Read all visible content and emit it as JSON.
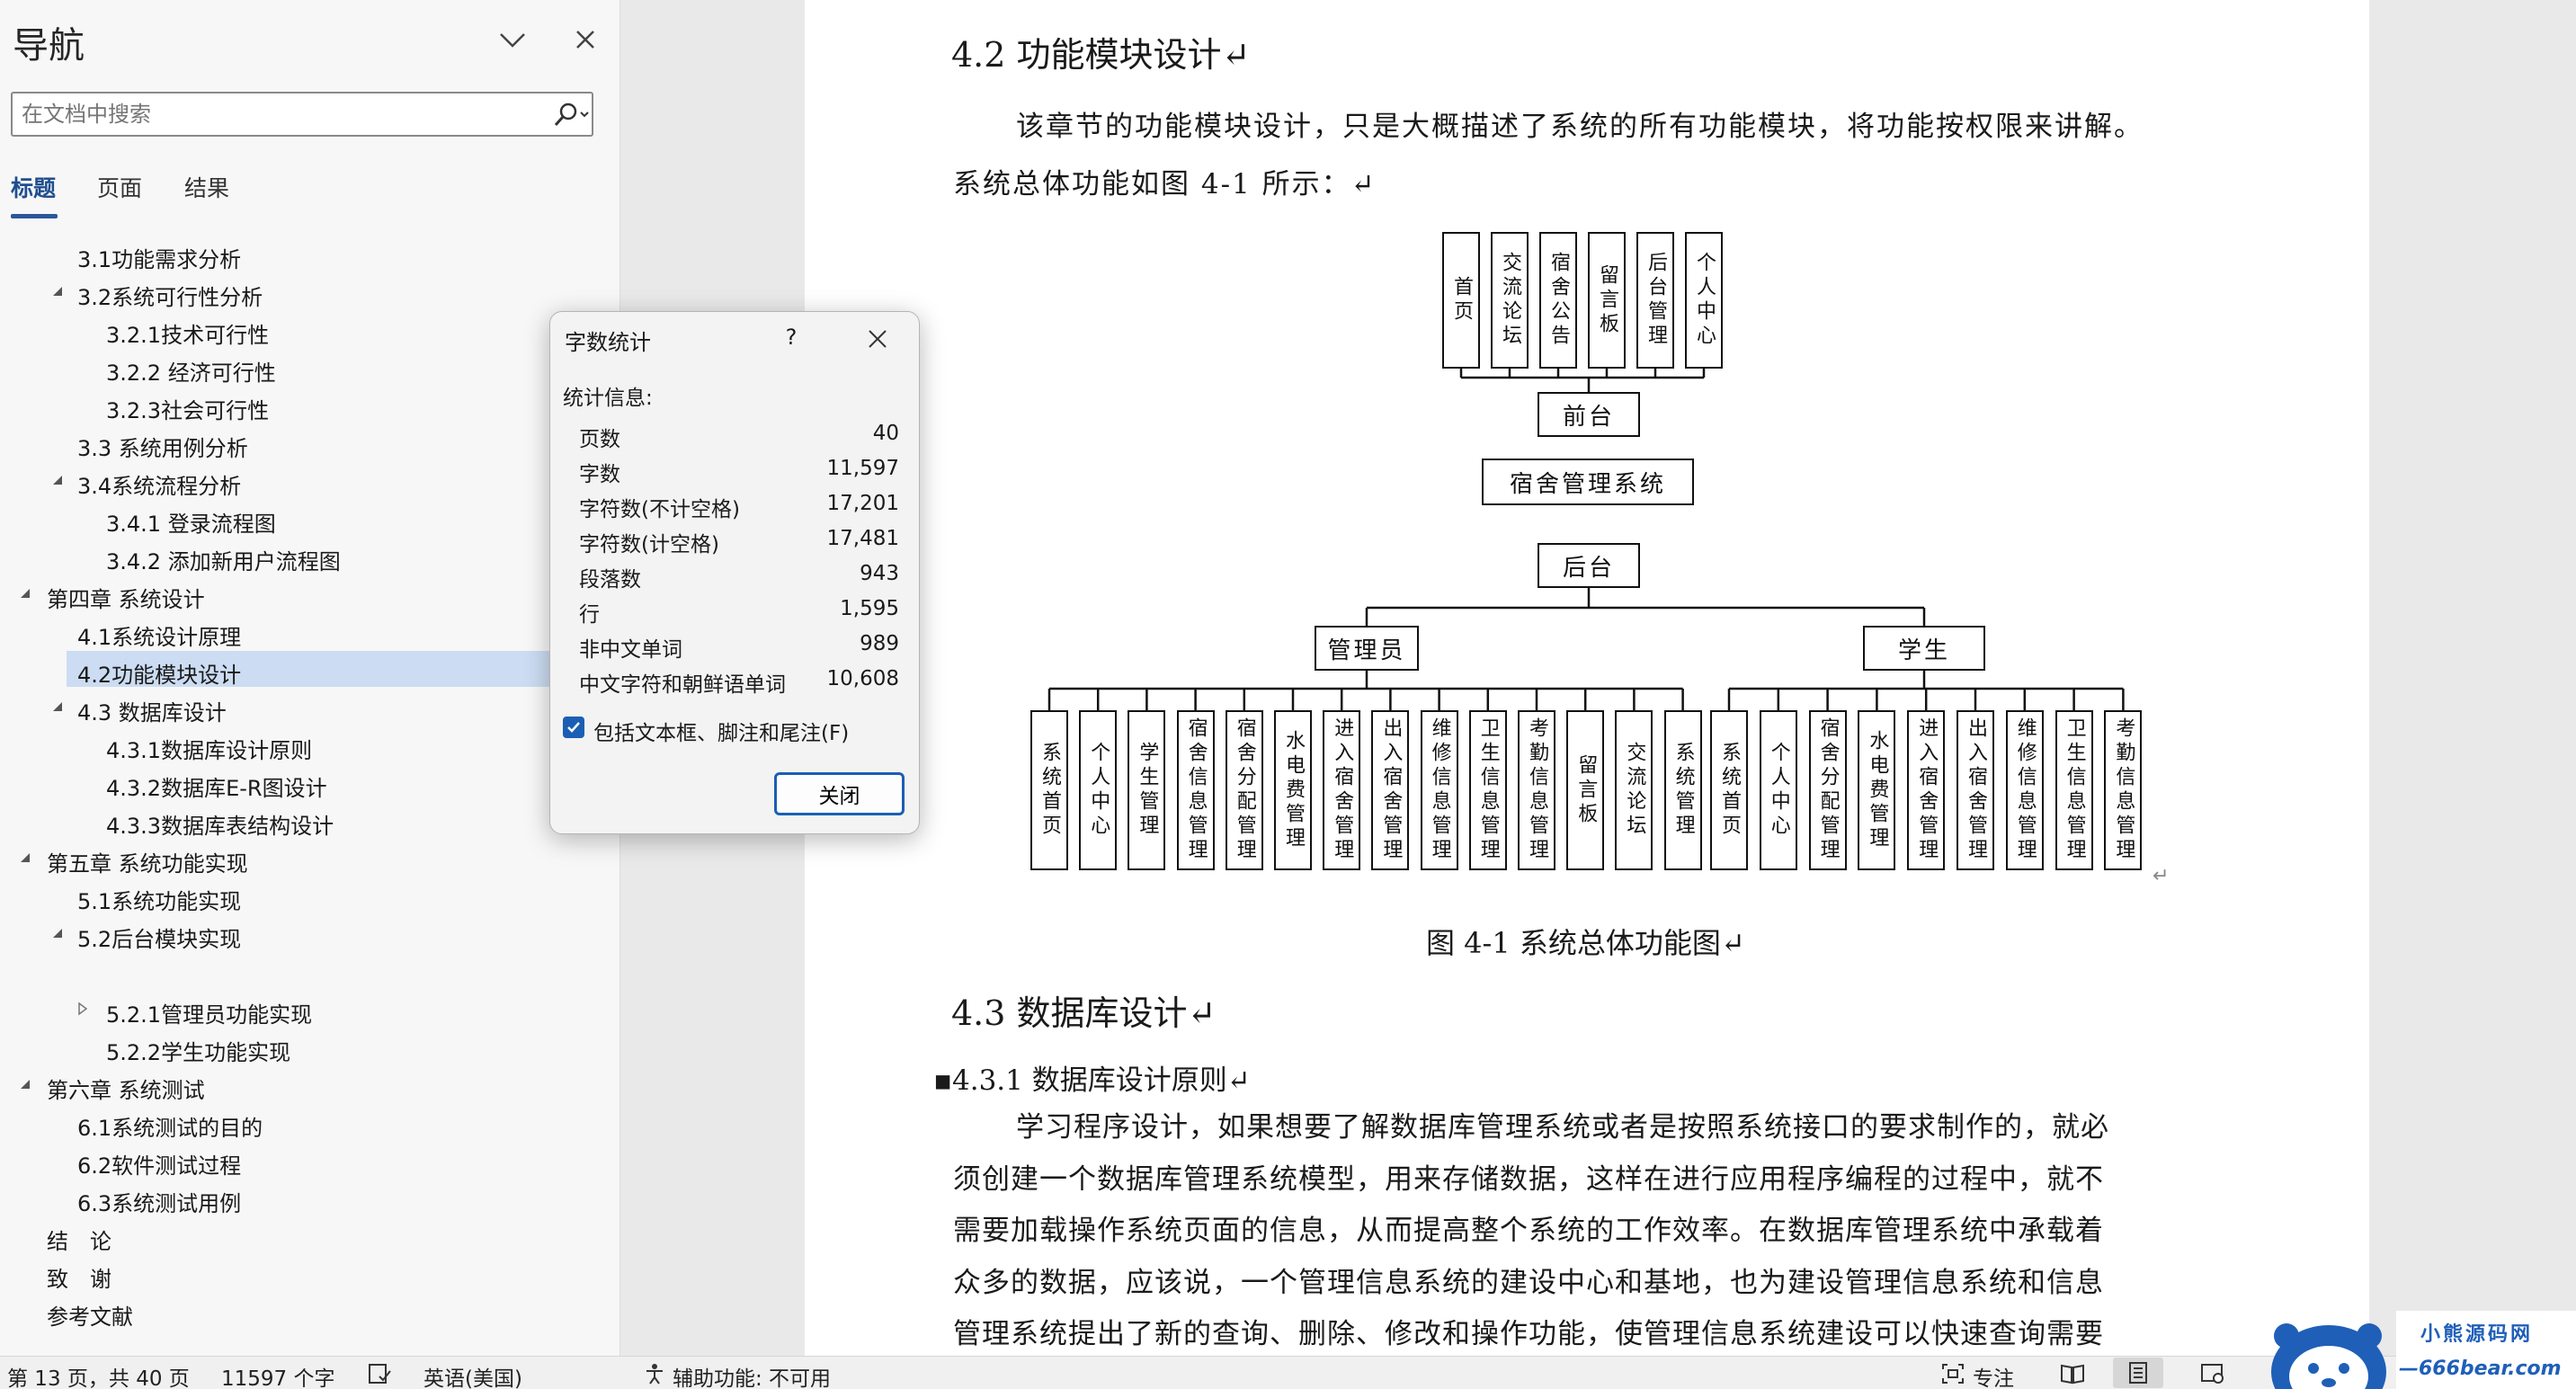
{
  "nav": {
    "title": "导航",
    "search_placeholder": "在文档中搜索",
    "tabs": [
      "标题",
      "页面",
      "结果"
    ],
    "items": [
      {
        "label": "3.1功能需求分析",
        "level": 2,
        "arrow": ""
      },
      {
        "label": "3.2系统可行性分析",
        "level": 2,
        "arrow": "down"
      },
      {
        "label": "3.2.1技术可行性",
        "level": 3,
        "arrow": ""
      },
      {
        "label": "3.2.2 经济可行性",
        "level": 3,
        "arrow": ""
      },
      {
        "label": "3.2.3社会可行性",
        "level": 3,
        "arrow": ""
      },
      {
        "label": "3.3 系统用例分析",
        "level": 2,
        "arrow": ""
      },
      {
        "label": "3.4系统流程分析",
        "level": 2,
        "arrow": "down"
      },
      {
        "label": "3.4.1 登录流程图",
        "level": 3,
        "arrow": ""
      },
      {
        "label": "3.4.2 添加新用户流程图",
        "level": 3,
        "arrow": ""
      },
      {
        "label": "第四章 系统设计",
        "level": 1,
        "arrow": "down"
      },
      {
        "label": "4.1系统设计原理",
        "level": 2,
        "arrow": ""
      },
      {
        "label": "4.2功能模块设计",
        "level": 2,
        "arrow": "",
        "selected": true
      },
      {
        "label": "4.3 数据库设计",
        "level": 2,
        "arrow": "down"
      },
      {
        "label": "4.3.1数据库设计原则",
        "level": 3,
        "arrow": ""
      },
      {
        "label": "4.3.2数据库E-R图设计",
        "level": 3,
        "arrow": ""
      },
      {
        "label": "4.3.3数据库表结构设计",
        "level": 3,
        "arrow": ""
      },
      {
        "label": "第五章 系统功能实现",
        "level": 1,
        "arrow": "down"
      },
      {
        "label": "5.1系统功能实现",
        "level": 2,
        "arrow": ""
      },
      {
        "label": "5.2后台模块实现",
        "level": 2,
        "arrow": "down"
      },
      {
        "label": "",
        "level": 3,
        "arrow": ""
      },
      {
        "label": "5.2.1管理员功能实现",
        "level": 3,
        "arrow": "right"
      },
      {
        "label": "5.2.2学生功能实现",
        "level": 3,
        "arrow": ""
      },
      {
        "label": "第六章 系统测试",
        "level": 1,
        "arrow": "down"
      },
      {
        "label": "6.1系统测试的目的",
        "level": 2,
        "arrow": ""
      },
      {
        "label": "6.2软件测试过程",
        "level": 2,
        "arrow": ""
      },
      {
        "label": "6.3系统测试用例",
        "level": 2,
        "arrow": ""
      },
      {
        "label": "结　论",
        "level": 1,
        "arrow": ""
      },
      {
        "label": "致　谢",
        "level": 1,
        "arrow": ""
      },
      {
        "label": "参考文献",
        "level": 1,
        "arrow": ""
      }
    ]
  },
  "doc": {
    "heading_42": "4.2 功能模块设计↵",
    "para1_line1": "该章节的功能模块设计，只是大概描述了系统的所有功能模块，将功能按权限来讲解。",
    "para1_line2": "系统总体功能如图 4-1 所示：↵",
    "figure_caption": "图 4-1  系统总体功能图↵",
    "heading_43": "4.3  数据库设计↵",
    "heading_431": "▪4.3.1 数据库设计原则↵",
    "body_lines": [
      "学习程序设计，如果想要了解数据库管理系统或者是按照系统接口的要求制作的，就必",
      "须创建一个数据库管理系统模型，用来存储数据，这样在进行应用程序编程的过程中，就不",
      "需要加载操作系统页面的信息，从而提高整个系统的工作效率。在数据库管理系统中承载着",
      "众多的数据，应该说，一个管理信息系统的建设中心和基地，也为建设管理信息系统和信息",
      "管理系统提出了新的查询、删除、修改和操作功能，使管理信息系统建设可以快速查询需要"
    ],
    "diagram": {
      "front_modules": [
        "首页",
        "交流论坛",
        "宿舍公告",
        "留言板",
        "后台管理",
        "个人中心"
      ],
      "front": "前台",
      "root": "宿舍管理系统",
      "back": "后台",
      "admin": "管理员",
      "student": "学生",
      "admin_modules": [
        "系统首页",
        "个人中心",
        "学生管理",
        "宿舍信息管理",
        "宿舍分配管理",
        "水电费管理",
        "进入宿舍管理",
        "出入宿舍管理",
        "维修信息管理",
        "卫生信息管理",
        "考勤信息管理",
        "留言板",
        "交流论坛",
        "系统管理"
      ],
      "student_modules": [
        "系统首页",
        "个人中心",
        "宿舍分配管理",
        "水电费管理",
        "进入宿舍管理",
        "出入宿舍管理",
        "维修信息管理",
        "卫生信息管理",
        "考勤信息管理"
      ],
      "return_mark": "↵"
    }
  },
  "dialog": {
    "title": "字数统计",
    "help": "?",
    "stats_label": "统计信息:",
    "stats": [
      {
        "k": "页数",
        "v": "40"
      },
      {
        "k": "字数",
        "v": "11,597"
      },
      {
        "k": "字符数(不计空格)",
        "v": "17,201"
      },
      {
        "k": "字符数(计空格)",
        "v": "17,481"
      },
      {
        "k": "段落数",
        "v": "943"
      },
      {
        "k": "行",
        "v": "1,595"
      },
      {
        "k": "非中文单词",
        "v": "989"
      },
      {
        "k": "中文字符和朝鲜语单词",
        "v": "10,608"
      }
    ],
    "include_label": "包括文本框、脚注和尾注(F)",
    "include_checked": true,
    "close_label": "关闭"
  },
  "status": {
    "page": "第 13 页，共 40 页",
    "words": "11597 个字",
    "language": "英语(美国)",
    "accessibility": "辅助功能: 不可用",
    "focus": "专注"
  },
  "watermark": {
    "line1": "小熊源码网",
    "line2": "—666bear.com—"
  },
  "colors": {
    "accent": "#2b579a",
    "selection": "#ccdcf2",
    "checkbox": "#1a5fb4"
  }
}
